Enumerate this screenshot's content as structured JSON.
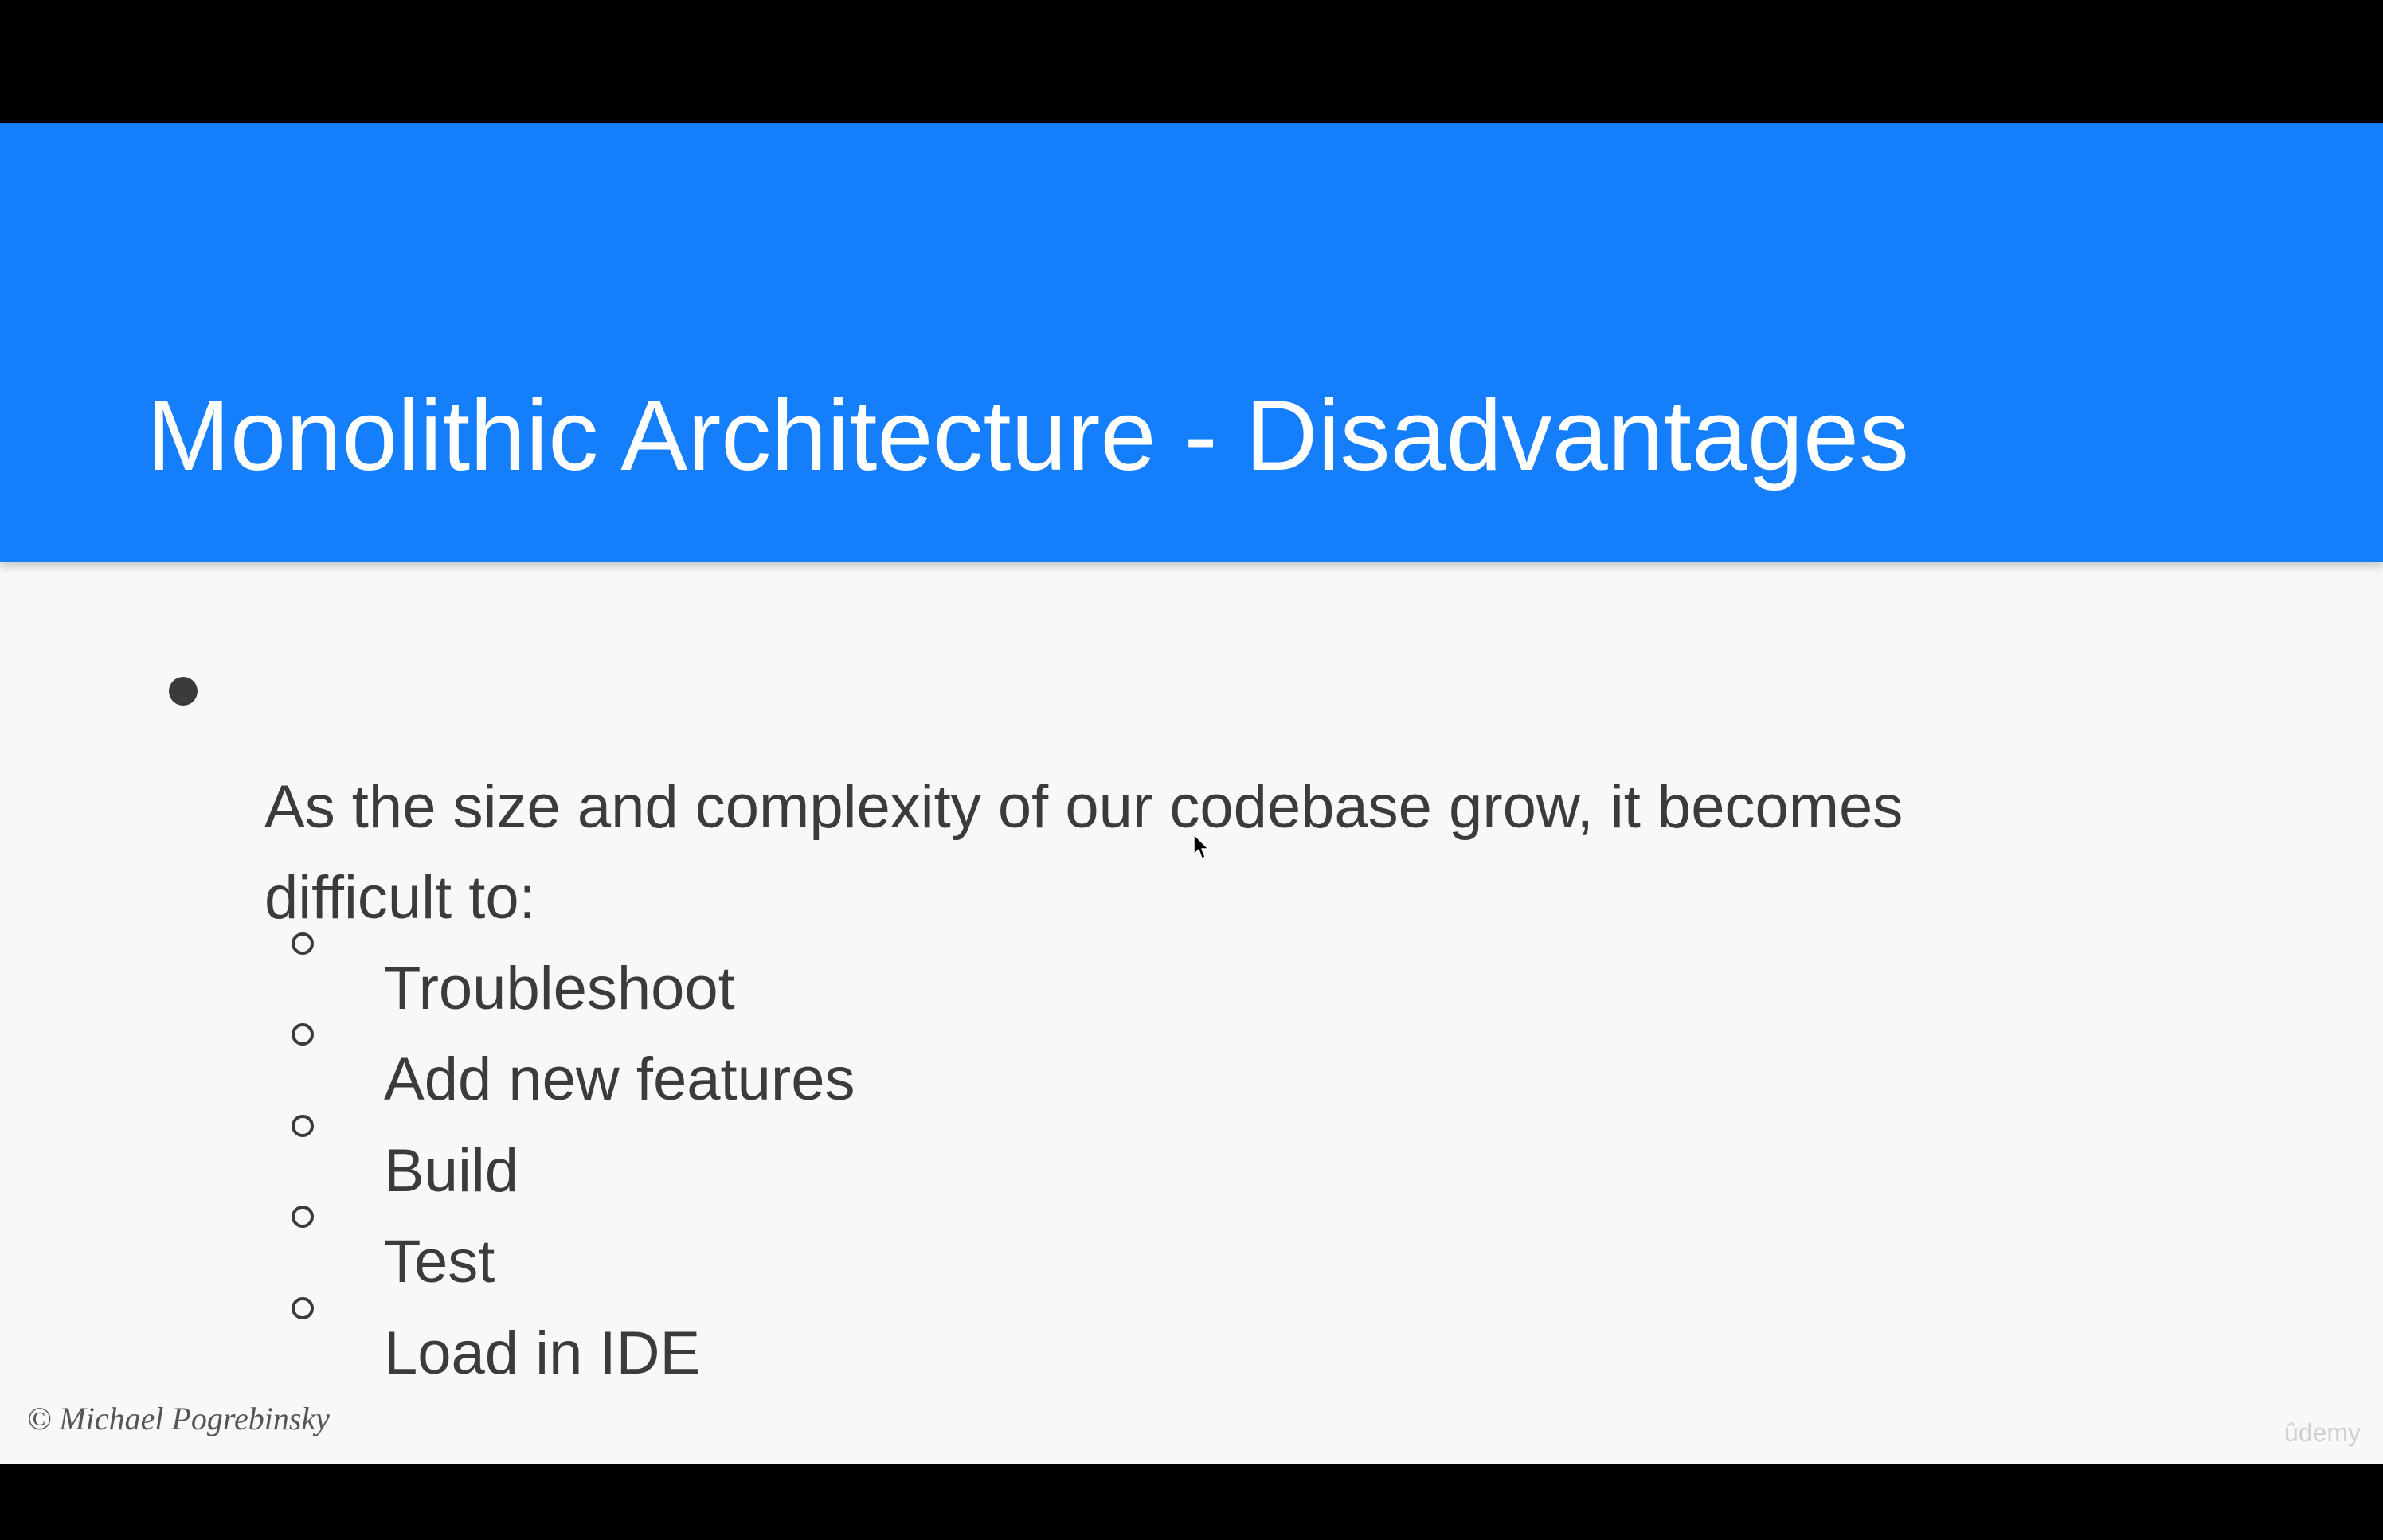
{
  "slide": {
    "title": "Monolithic Architecture - Disadvantages",
    "main_bullet": {
      "line1": "As the size and complexity of our codebase grow, it becomes",
      "line2": "difficult to:"
    },
    "sub_bullets": [
      {
        "text": "Troubleshoot"
      },
      {
        "text": "Add new features"
      },
      {
        "text": "Build"
      },
      {
        "text": "Test"
      },
      {
        "text": "Load in IDE"
      }
    ],
    "copyright": "© Michael Pogrebinsky",
    "watermark": "ûdemy"
  },
  "colors": {
    "title_bar": "#157efb",
    "slide_background": "#f8f8f8",
    "letterbox": "#000000",
    "body_text": "#3b3b3b"
  },
  "icons": {
    "main_bullet": "filled-circle-bullet-icon",
    "sub_bullet": "hollow-circle-bullet-icon",
    "pointer": "mouse-cursor-icon"
  }
}
